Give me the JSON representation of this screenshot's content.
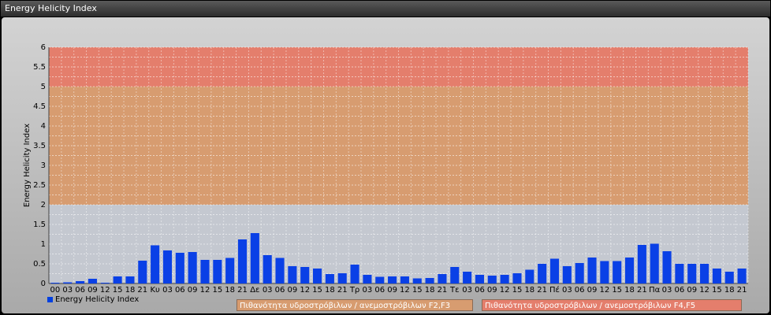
{
  "window": {
    "title": "Energy Helicity Index"
  },
  "colors": {
    "bar": "#0a40e6",
    "low_zone": "#c4c8d0",
    "mid_zone": "#e6a46a",
    "high_zone": "#e88068"
  },
  "zones": [
    {
      "label": "Πιθανότητα υδροστρόβιλων / ανεμοστρόβιλων F2,F3",
      "from": 2,
      "to": 5,
      "color": "#d79c70"
    },
    {
      "label": "Πιθανότητα υδροστρόβιλων / ανεμοστρόβιλων F4,F5",
      "from": 5,
      "to": 6,
      "color": "#e47e6c"
    }
  ],
  "chart_data": {
    "type": "bar",
    "ylabel": "Energy Helicity Index",
    "ylim": [
      0,
      6
    ],
    "yticks": [
      "0",
      "0.5",
      "1",
      "1.5",
      "2",
      "2.5",
      "3",
      "3.5",
      "4",
      "4.5",
      "5",
      "5.5",
      "6"
    ],
    "grid": true,
    "legend": "bottom-left",
    "categories": [
      "00",
      "03",
      "06",
      "09",
      "12",
      "15",
      "18",
      "21",
      "Κυ",
      "03",
      "06",
      "09",
      "12",
      "15",
      "18",
      "21",
      "Δε",
      "03",
      "06",
      "09",
      "12",
      "15",
      "18",
      "21",
      "Τρ",
      "03",
      "06",
      "09",
      "12",
      "15",
      "18",
      "21",
      "Τε",
      "03",
      "06",
      "09",
      "12",
      "15",
      "18",
      "21",
      "Πέ",
      "03",
      "06",
      "09",
      "12",
      "15",
      "18",
      "21",
      "Πα",
      "03",
      "06",
      "09",
      "12",
      "15",
      "18",
      "21"
    ],
    "series": [
      {
        "name": "Energy Helicity Index",
        "values": [
          0.02,
          0.03,
          0.06,
          0.12,
          0.02,
          0.18,
          0.18,
          0.58,
          0.97,
          0.84,
          0.78,
          0.8,
          0.6,
          0.6,
          0.65,
          1.12,
          1.28,
          0.72,
          0.65,
          0.44,
          0.42,
          0.38,
          0.24,
          0.26,
          0.48,
          0.22,
          0.17,
          0.18,
          0.18,
          0.13,
          0.14,
          0.24,
          0.42,
          0.3,
          0.22,
          0.2,
          0.22,
          0.26,
          0.35,
          0.5,
          0.63,
          0.44,
          0.52,
          0.66,
          0.57,
          0.57,
          0.66,
          0.98,
          1.01,
          0.82,
          0.5,
          0.5,
          0.5,
          0.38,
          0.3,
          0.38
        ]
      }
    ]
  }
}
